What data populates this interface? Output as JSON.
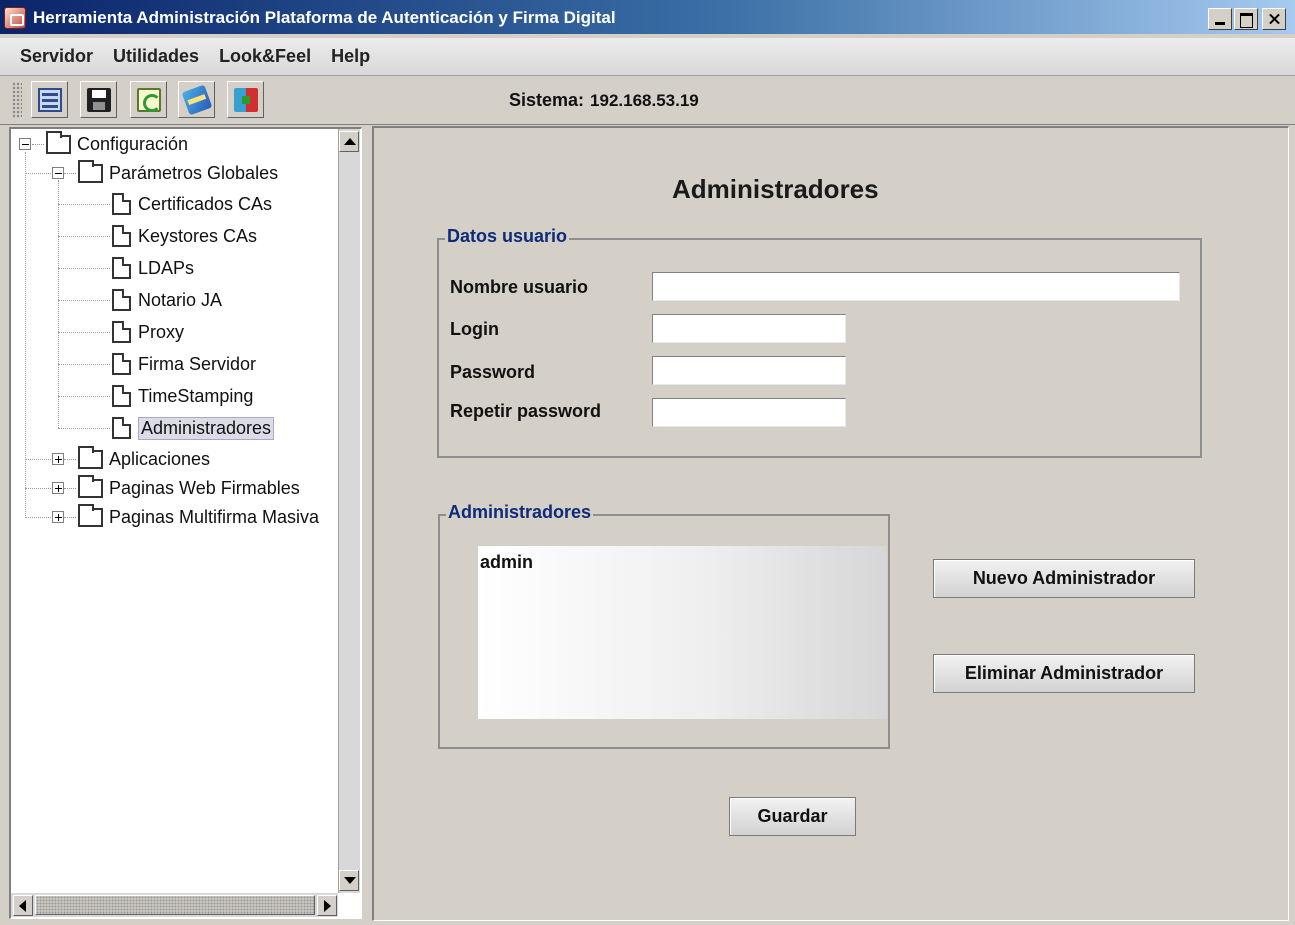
{
  "window": {
    "title": "Herramienta Administración Plataforma de Autenticación y Firma Digital"
  },
  "menu": [
    "Servidor",
    "Utilidades",
    "Look&Feel",
    "Help"
  ],
  "toolbar": {
    "buttons": [
      "server-icon",
      "save-icon",
      "refresh-icon",
      "book-icon",
      "exit-icon"
    ],
    "sistema_label": "Sistema:",
    "sistema_ip": "192.168.53.19"
  },
  "tree": {
    "root": "Configuración",
    "global": "Parámetros Globales",
    "children": [
      "Certificados CAs",
      "Keystores CAs",
      "LDAPs",
      "Notario JA",
      "Proxy",
      "Firma Servidor",
      "TimeStamping",
      "Administradores"
    ],
    "selected": "Administradores",
    "others": [
      "Aplicaciones",
      "Paginas Web Firmables",
      "Paginas Multifirma Masiva"
    ]
  },
  "main": {
    "title": "Administradores",
    "datos_usuario": {
      "legend": "Datos usuario",
      "labels": [
        "Nombre usuario",
        "Login",
        "Password",
        "Repetir password"
      ],
      "values": [
        "",
        "",
        "",
        ""
      ]
    },
    "administradores": {
      "legend": "Administradores",
      "items": [
        "admin"
      ]
    },
    "buttons": {
      "nuevo": "Nuevo Administrador",
      "eliminar": "Eliminar Administrador",
      "guardar": "Guardar"
    }
  },
  "colors": {
    "titlebar": "#0a246a",
    "legend": "#0f2a78",
    "background": "#d4d0c8"
  }
}
